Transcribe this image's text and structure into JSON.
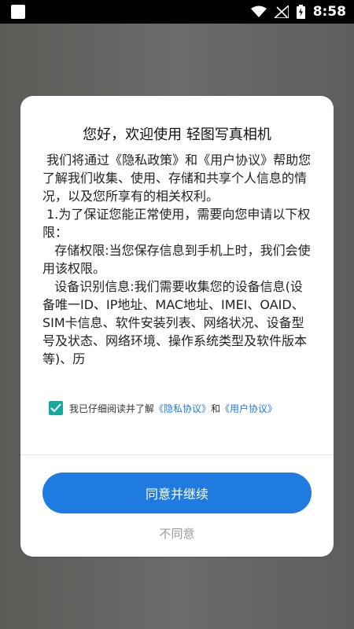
{
  "status_bar": {
    "time": "8:58"
  },
  "dialog": {
    "title": "您好，欢迎使用 轻图写真相机",
    "policy_paragraphs": [
      " 我们将通过《隐私政策》和《用户协议》帮助您了解我们收集、使用、存储和共享个人信息的情况，以及您所享有的相关权利。",
      " 1.为了保证您能正常使用，需要向您申请以下权限：",
      "   存储权限:当您保存信息到手机上时，我们会使用该权限。",
      "   设备识别信息:我们需要收集您的设备信息(设备唯一ID、IP地址、MAC地址、IMEI、OAID、SIM卡信息、软件安装列表、网络状况、设备型号及状态、网络环境、操作系统类型及软件版本等)、历"
    ],
    "consent": {
      "checked": true,
      "prefix": "我已仔细阅读并了解",
      "privacy_link": "《隐私协议》",
      "and": "和",
      "user_link": "《用户协议》"
    },
    "agree_button": "同意并继续",
    "disagree_link": "不同意"
  },
  "colors": {
    "primary": "#1f7be0",
    "checkbox": "#16a89a",
    "link": "#1f7ad6",
    "muted": "#9a9a9a"
  },
  "icons": {
    "wifi": "wifi-icon",
    "signal": "signal-icon",
    "battery": "battery-charging-icon"
  }
}
